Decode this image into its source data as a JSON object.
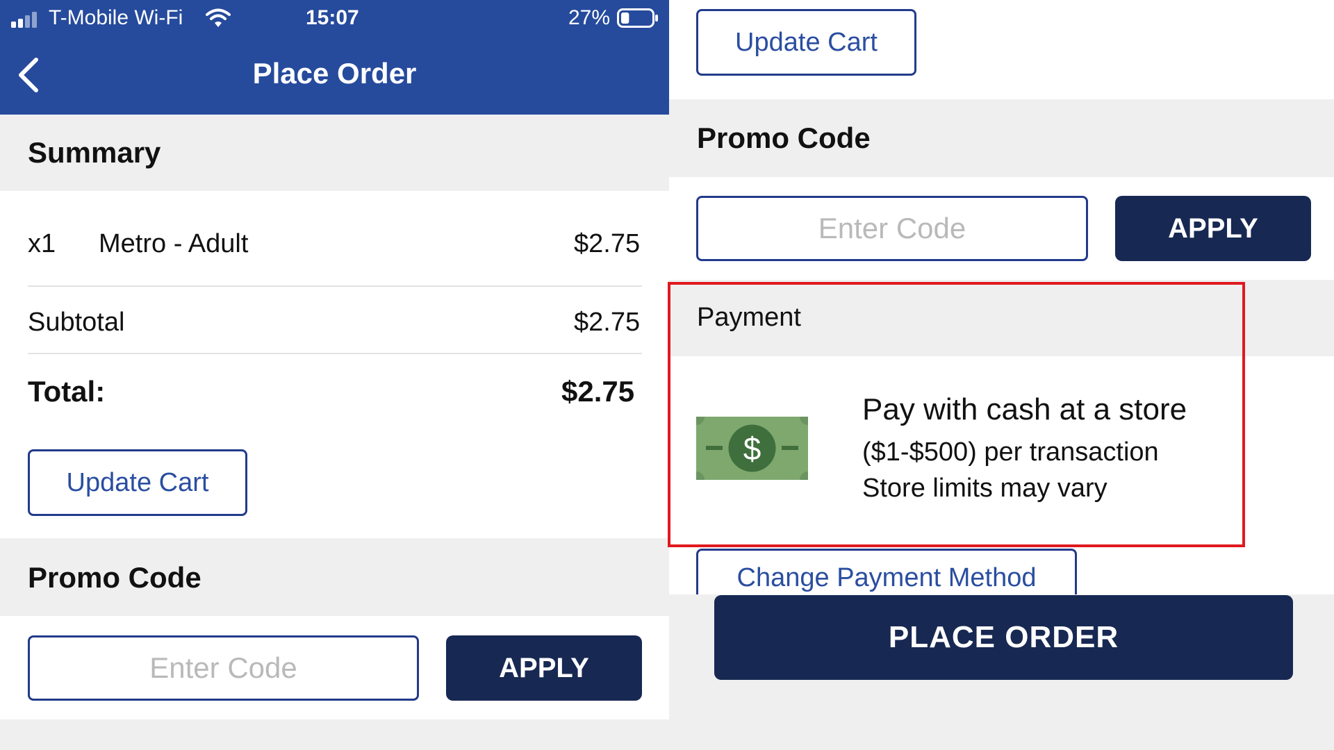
{
  "status_bar": {
    "carrier": "T-Mobile Wi-Fi",
    "time": "15:07",
    "battery": "27%",
    "battery_level": 0.27
  },
  "nav": {
    "title": "Place Order",
    "back_icon": "chevron-left-icon"
  },
  "summary": {
    "title": "Summary",
    "item": {
      "qty": "x1",
      "name": "Metro - Adult",
      "price": "$2.75"
    },
    "subtotal_label": "Subtotal",
    "subtotal_value": "$2.75",
    "total_label": "Total:",
    "total_value": "$2.75"
  },
  "update_cart_label": "Update Cart",
  "promo": {
    "title": "Promo Code",
    "placeholder": "Enter Code",
    "apply_label": "APPLY"
  },
  "payment": {
    "title": "Payment",
    "method_icon": "cash-bill-icon",
    "method_title": "Pay with cash at a store",
    "line1": "($1-$500) per transaction",
    "line2": "Store limits may vary",
    "change_label": "Change Payment Method",
    "highlight_color": "#e0191f"
  },
  "place_order_label": "PLACE ORDER",
  "colors": {
    "nav_blue": "#264b9d",
    "button_navy": "#172852",
    "link_blue": "#2a4ea0"
  }
}
